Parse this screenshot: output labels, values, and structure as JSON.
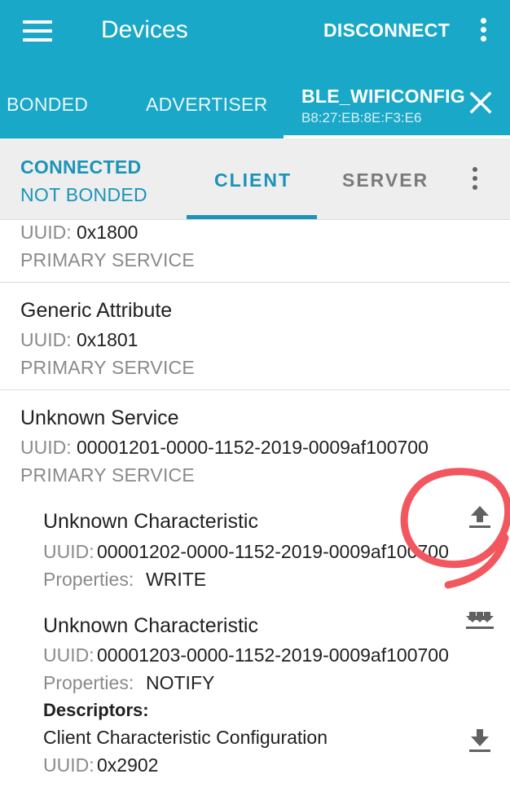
{
  "appbar": {
    "title": "Devices",
    "disconnect_label": "DISCONNECT",
    "tabs": [
      {
        "label": "BONDED"
      },
      {
        "label": "ADVERTISER"
      }
    ],
    "active_device": {
      "name": "BLE_WIFICONFIG",
      "address": "B8:27:EB:8E:F3:E6"
    }
  },
  "subbar": {
    "connection_status": "CONNECTED",
    "bond_status": "NOT BONDED",
    "tabs": [
      {
        "label": "CLIENT",
        "active": true
      },
      {
        "label": "SERVER",
        "active": false
      }
    ]
  },
  "services": [
    {
      "name": "",
      "uuid_label": "UUID:",
      "uuid": "0x1800",
      "type": "PRIMARY SERVICE"
    },
    {
      "name": "Generic Attribute",
      "uuid_label": "UUID:",
      "uuid": "0x1801",
      "type": "PRIMARY SERVICE"
    },
    {
      "name": "Unknown Service",
      "uuid_label": "UUID:",
      "uuid": "00001201-0000-1152-2019-0009af100700",
      "type": "PRIMARY SERVICE",
      "characteristics": [
        {
          "name": "Unknown Characteristic",
          "uuid_label": "UUID:",
          "uuid": "00001202-0000-1152-2019-0009af100700",
          "properties_label": "Properties:",
          "properties": "WRITE",
          "action_icon": "upload-arrow-icon"
        },
        {
          "name": "Unknown Characteristic",
          "uuid_label": "UUID:",
          "uuid": "00001203-0000-1152-2019-0009af100700",
          "properties_label": "Properties:",
          "properties": "NOTIFY",
          "action_icon": "multi-download-arrows-icon",
          "descriptors_label": "Descriptors:",
          "descriptors": [
            {
              "name": "Client Characteristic Configuration",
              "uuid_label": "UUID:",
              "uuid": "0x2902",
              "action_icon": "download-arrow-icon"
            }
          ]
        }
      ]
    }
  ],
  "colors": {
    "appbar": "#1aa8c8",
    "accent": "#1a94b8",
    "annotation": "#f2575f"
  }
}
